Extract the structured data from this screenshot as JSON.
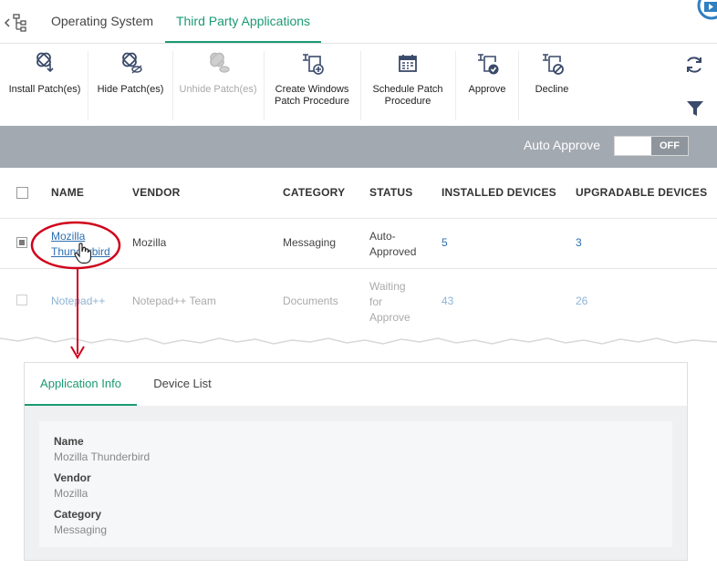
{
  "tabs": [
    {
      "label": "Operating System",
      "active": false
    },
    {
      "label": "Third Party Applications",
      "active": true
    }
  ],
  "toolbar": {
    "install": "Install Patch(es)",
    "hide": "Hide Patch(es)",
    "unhide": "Unhide Patch(es)",
    "create_line1": "Create Windows",
    "create_line2": "Patch Procedure",
    "schedule_line1": "Schedule Patch",
    "schedule_line2": "Procedure",
    "approve": "Approve",
    "decline": "Decline"
  },
  "auto_approve": {
    "label": "Auto Approve",
    "state": "OFF"
  },
  "table": {
    "headers": [
      "NAME",
      "VENDOR",
      "CATEGORY",
      "STATUS",
      "INSTALLED DEVICES",
      "UPGRADABLE DEVICES"
    ],
    "rows": [
      {
        "name_line1": "Mozilla",
        "name_line2": "Thunderbird",
        "vendor": "Mozilla",
        "category": "Messaging",
        "status_line1": "Auto-",
        "status_line2": "Approved",
        "installed": "5",
        "upgradable": "3"
      },
      {
        "name": "Notepad++",
        "vendor": "Notepad++ Team",
        "category": "Documents",
        "status_line1": "Waiting",
        "status_line2": "for",
        "status_line3": "Approve",
        "installed": "43",
        "upgradable": "26"
      }
    ]
  },
  "detail": {
    "tabs": [
      "Application Info",
      "Device List"
    ],
    "fields": [
      {
        "label": "Name",
        "value": "Mozilla Thunderbird"
      },
      {
        "label": "Vendor",
        "value": "Mozilla"
      },
      {
        "label": "Category",
        "value": "Messaging"
      }
    ]
  },
  "colors": {
    "accent": "#1a9a73",
    "link": "#2b6fb0",
    "annotation": "#d0021b",
    "bar": "#a3a9b1"
  }
}
